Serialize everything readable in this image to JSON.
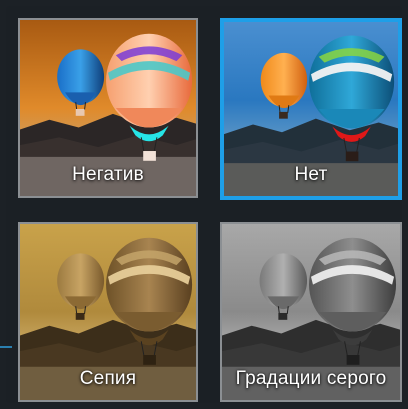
{
  "filters": [
    {
      "label": "Негатив",
      "selected": false
    },
    {
      "label": "Нет",
      "selected": true
    },
    {
      "label": "Сепия",
      "selected": false
    },
    {
      "label": "Градации серого",
      "selected": false
    }
  ],
  "colors": {
    "accent": "#1e9fe8",
    "tile_border": "#8b8f93",
    "background": "#1c2126"
  }
}
